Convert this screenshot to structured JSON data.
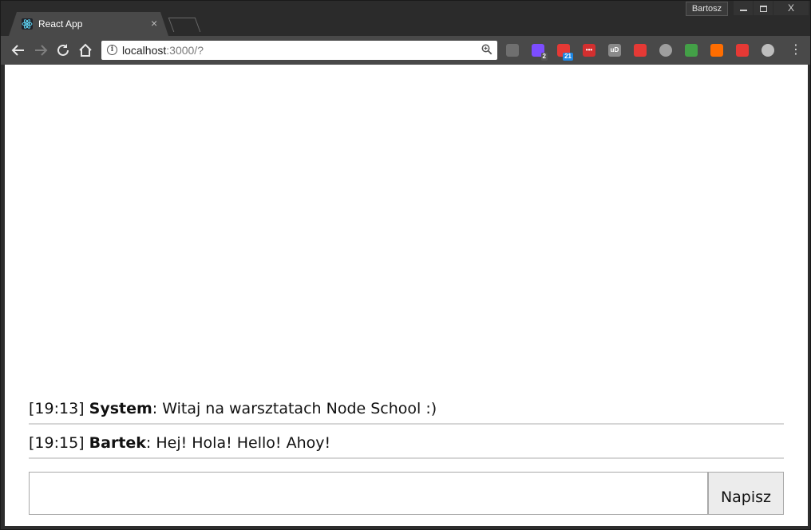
{
  "browser": {
    "tab": {
      "title": "React App",
      "close": "×"
    },
    "profile": "Bartosz",
    "window_controls": {
      "close": "X"
    },
    "address": {
      "host": "localhost",
      "rest": ":3000/?"
    },
    "menu": "⋮",
    "extensions": [
      {
        "name": "mail-icon",
        "color": "#6f6f6f"
      },
      {
        "name": "feedly-icon",
        "color": "#7c4dff",
        "badge": "2",
        "badge_color": "#555555"
      },
      {
        "name": "calendar-icon",
        "color": "#e53935",
        "badge": "21",
        "badge_color": "#1e88e5"
      },
      {
        "name": "lastpass-icon",
        "color": "#d32f2f",
        "glyph": "•••"
      },
      {
        "name": "ublock-icon",
        "color": "#8a8a8a",
        "glyph": "uD"
      },
      {
        "name": "dashlane-icon",
        "color": "#e53935"
      },
      {
        "name": "camera-icon",
        "color": "#9e9e9e"
      },
      {
        "name": "color-picker-icon",
        "color": "#43a047"
      },
      {
        "name": "orange-extension-icon",
        "color": "#ff6d00"
      },
      {
        "name": "red-extension-icon",
        "color": "#e53935"
      },
      {
        "name": "target-icon",
        "color": "#bdbdbd"
      }
    ]
  },
  "chat": {
    "messages": [
      {
        "time": "[19:13]",
        "author": "System",
        "text": ": Witaj na warsztatach Node School :)"
      },
      {
        "time": "[19:15]",
        "author": "Bartek",
        "text": ": Hej! Hola! Hello! Ahoy!"
      }
    ],
    "input_value": "",
    "send_label": "Napisz"
  }
}
